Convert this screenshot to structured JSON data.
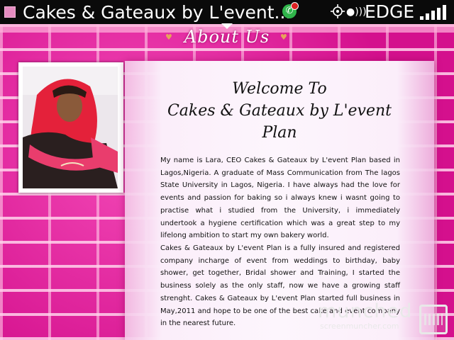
{
  "status_bar": {
    "title": "Cakes & Gateaux by L'event...",
    "network": "EDGE",
    "icons": [
      "app-icon",
      "whatsapp-icon",
      "gps-icon",
      "signal-icon",
      "signal-bars-icon"
    ]
  },
  "page": {
    "title": "About Us",
    "welcome_line1": "Welcome To",
    "welcome_line2": "Cakes & Gateaux by L'event",
    "welcome_line3": "Plan",
    "paragraph1": "My name is Lara, CEO Cakes & Gateaux by L'event Plan based in Lagos,Nigeria. A graduate of Mass Communication from The lagos State University in Lagos, Nigeria. I have always had the love for events and passion for baking so i always knew i wasnt going to practise what i studied from the University, i immediately undertook a hygiene certification which was a great step to my lifelong ambition to start my own bakery world.",
    "paragraph2": "Cakes & Gateaux by L'event Plan is a fully insured and registered company incharge of event from weddings to birthday, baby shower, get together, Bridal shower and Training, I started the business solely as the only staff, now we have a growing staff strenght. Cakes & Gateaux by L'event Plan started full business in May,2011 and hope to be one of the best cake and event company in the nearest future."
  },
  "watermark": {
    "main": "munched",
    "sub": "screenmuncher.com"
  },
  "colors": {
    "brick": "#e7139a",
    "panel": "#fdf6fd",
    "status_bar": "#0a0a0a"
  }
}
